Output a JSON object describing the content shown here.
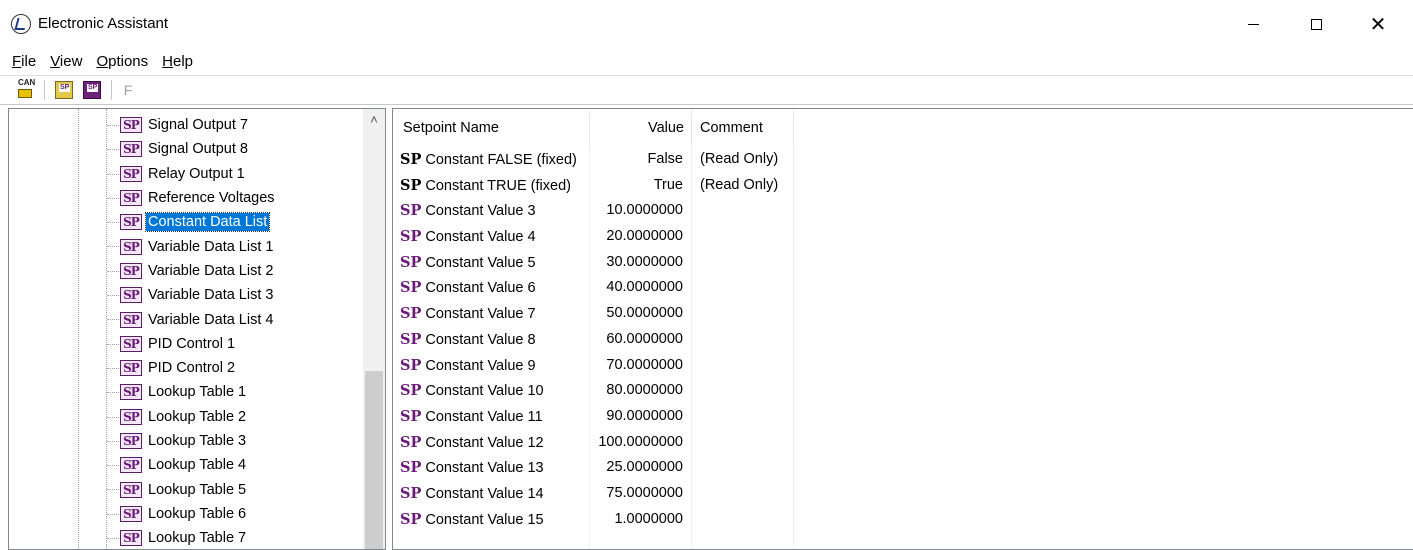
{
  "window": {
    "title": "Electronic Assistant",
    "minimize": "—",
    "maximize": "□",
    "close": "✕"
  },
  "menu": [
    {
      "label": "File",
      "hotkey": "F",
      "rest": "ile"
    },
    {
      "label": "View",
      "hotkey": "V",
      "rest": "iew"
    },
    {
      "label": "Options",
      "hotkey": "O",
      "rest": "ptions"
    },
    {
      "label": "Help",
      "hotkey": "H",
      "rest": "elp"
    }
  ],
  "toolbar": {
    "can_icon_label": "CAN",
    "f_button_label": "F",
    "icons": [
      "can-connect-icon",
      "open-setpoint-icon",
      "save-setpoint-icon",
      "flash-icon"
    ]
  },
  "tree": {
    "icon_text": "SP",
    "items": [
      {
        "label": "Signal Output 7",
        "selected": false
      },
      {
        "label": "Signal Output 8",
        "selected": false
      },
      {
        "label": "Relay Output 1",
        "selected": false
      },
      {
        "label": "Reference Voltages",
        "selected": false
      },
      {
        "label": "Constant Data List",
        "selected": true
      },
      {
        "label": "Variable Data List 1",
        "selected": false
      },
      {
        "label": "Variable Data List 2",
        "selected": false
      },
      {
        "label": "Variable Data List 3",
        "selected": false
      },
      {
        "label": "Variable Data List 4",
        "selected": false
      },
      {
        "label": "PID Control 1",
        "selected": false
      },
      {
        "label": "PID Control 2",
        "selected": false
      },
      {
        "label": "Lookup Table 1",
        "selected": false
      },
      {
        "label": "Lookup Table 2",
        "selected": false
      },
      {
        "label": "Lookup Table 3",
        "selected": false
      },
      {
        "label": "Lookup Table 4",
        "selected": false
      },
      {
        "label": "Lookup Table 5",
        "selected": false
      },
      {
        "label": "Lookup Table 6",
        "selected": false
      },
      {
        "label": "Lookup Table 7",
        "selected": false
      }
    ],
    "scroll_up_glyph": "^"
  },
  "table": {
    "columns": {
      "name": "Setpoint Name",
      "value": "Value",
      "comment": "Comment"
    },
    "sp_prefix": "SP",
    "rows": [
      {
        "name": "Constant FALSE (fixed)",
        "value": "False",
        "comment": "(Read Only)",
        "readonly": true
      },
      {
        "name": "Constant TRUE (fixed)",
        "value": "True",
        "comment": "(Read Only)",
        "readonly": true
      },
      {
        "name": "Constant Value 3",
        "value": "10.0000000",
        "comment": "",
        "readonly": false
      },
      {
        "name": "Constant Value 4",
        "value": "20.0000000",
        "comment": "",
        "readonly": false
      },
      {
        "name": "Constant Value 5",
        "value": "30.0000000",
        "comment": "",
        "readonly": false
      },
      {
        "name": "Constant Value 6",
        "value": "40.0000000",
        "comment": "",
        "readonly": false
      },
      {
        "name": "Constant Value 7",
        "value": "50.0000000",
        "comment": "",
        "readonly": false
      },
      {
        "name": "Constant Value 8",
        "value": "60.0000000",
        "comment": "",
        "readonly": false
      },
      {
        "name": "Constant Value 9",
        "value": "70.0000000",
        "comment": "",
        "readonly": false
      },
      {
        "name": "Constant Value 10",
        "value": "80.0000000",
        "comment": "",
        "readonly": false
      },
      {
        "name": "Constant Value 11",
        "value": "90.0000000",
        "comment": "",
        "readonly": false
      },
      {
        "name": "Constant Value 12",
        "value": "100.0000000",
        "comment": "",
        "readonly": false
      },
      {
        "name": "Constant Value 13",
        "value": "25.0000000",
        "comment": "",
        "readonly": false
      },
      {
        "name": "Constant Value 14",
        "value": "75.0000000",
        "comment": "",
        "readonly": false
      },
      {
        "name": "Constant Value 15",
        "value": "1.0000000",
        "comment": "",
        "readonly": false
      }
    ]
  },
  "colors": {
    "selection": "#0078d7",
    "sp_purple": "#6b1a7a",
    "sp_readonly": "#000000"
  }
}
